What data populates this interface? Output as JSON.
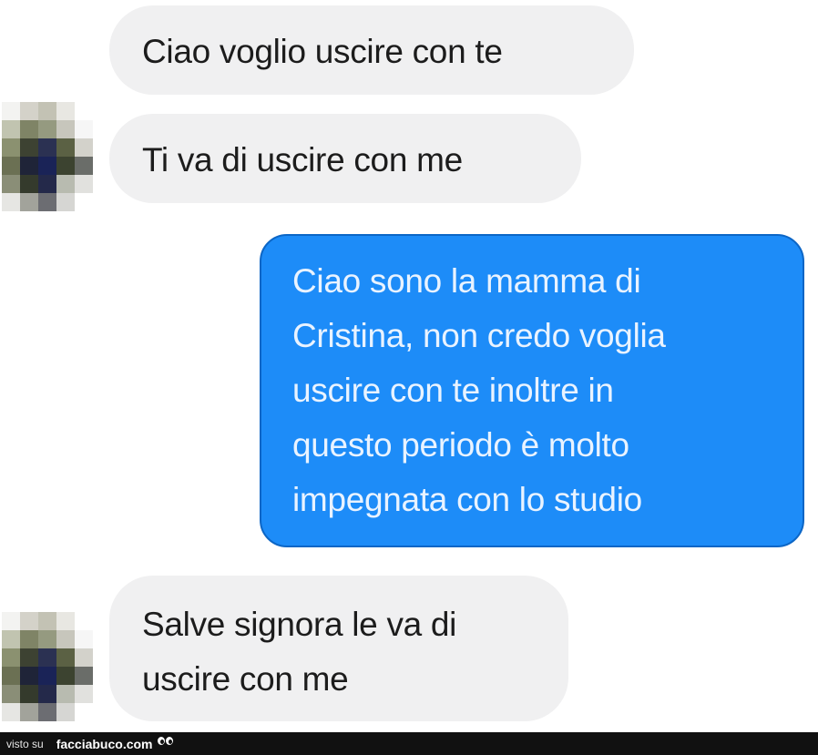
{
  "messages": [
    {
      "from": "them",
      "text": "Ciao voglio uscire con te"
    },
    {
      "from": "them",
      "text": "Ti va di uscire con me"
    },
    {
      "from": "me",
      "lines": [
        "Ciao sono la mamma di",
        "Cristina, non credo voglia",
        "uscire con te inoltre in",
        "questo periodo è molto",
        "impegnata con lo studio"
      ]
    },
    {
      "from": "them",
      "lines": [
        "Salve signora le va di",
        "uscire con me"
      ]
    }
  ],
  "footer": {
    "prefix": "visto su",
    "site": "facciabuco.com"
  },
  "colors": {
    "incoming_bubble": "#f0f0f1",
    "outgoing_bubble": "#1d8cf8",
    "outgoing_text": "#e9f3ff",
    "footer_bg": "#111111"
  },
  "avatar": {
    "style": "pixelated",
    "icon": "user-avatar-icon"
  }
}
